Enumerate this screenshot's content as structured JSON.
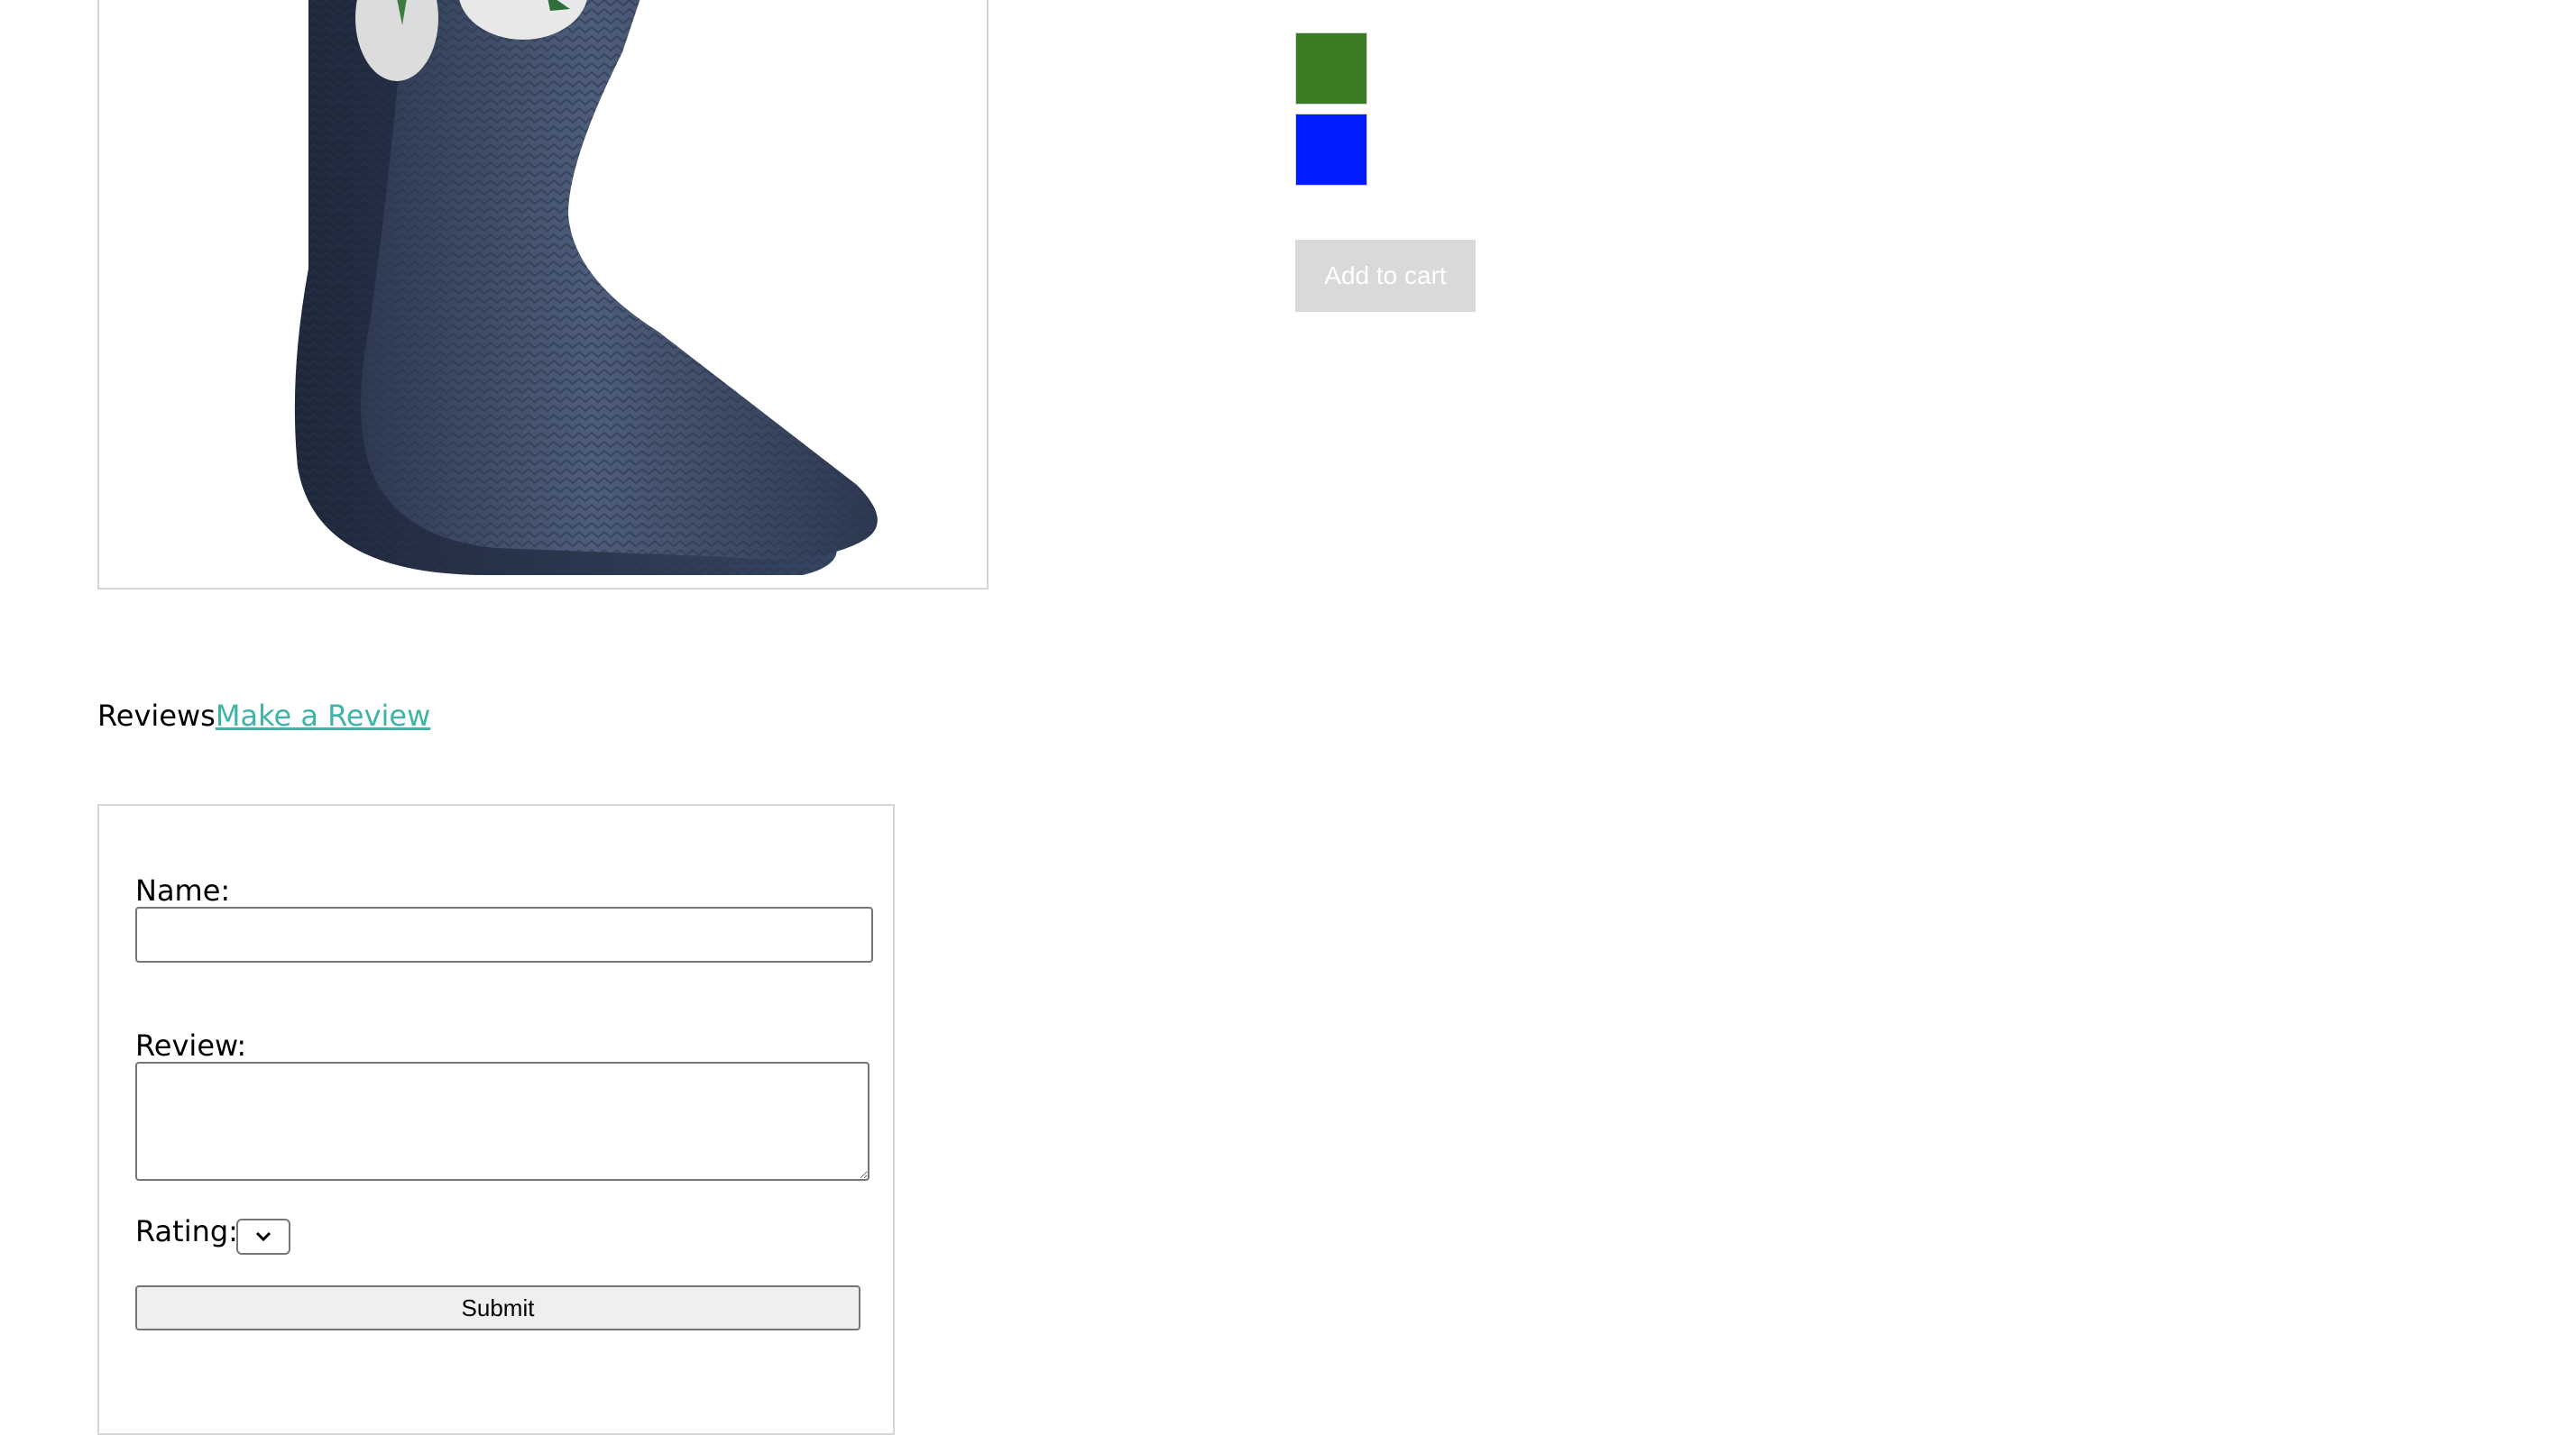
{
  "product": {
    "image_alt": "Navy knit socks",
    "swatches": [
      {
        "name": "green",
        "color": "#3a7d24"
      },
      {
        "name": "blue",
        "color": "#001cff"
      }
    ],
    "add_to_cart_label": "Add to cart"
  },
  "reviews": {
    "heading": "Reviews",
    "make_review_link": "Make a Review",
    "form": {
      "name_label": "Name:",
      "name_value": "",
      "review_label": "Review:",
      "review_value": "",
      "rating_label": "Rating:",
      "rating_value": "",
      "submit_label": "Submit"
    }
  }
}
